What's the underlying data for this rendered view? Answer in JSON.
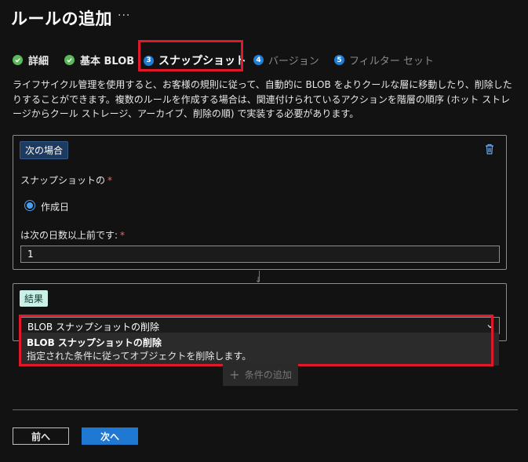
{
  "header": {
    "title": "ルールの追加",
    "more": "···"
  },
  "steps": [
    {
      "label": "詳細",
      "state": "done"
    },
    {
      "label": "基本 BLOB",
      "state": "done"
    },
    {
      "label": "スナップショット",
      "state": "active",
      "num": "3"
    },
    {
      "label": "バージョン",
      "state": "future",
      "num": "4"
    },
    {
      "label": "フィルター セット",
      "state": "future",
      "num": "5"
    }
  ],
  "description": "ライフサイクル管理を使用すると、お客様の規則に従って、自動的に BLOB をよりクールな層に移動したり、削除したりすることができます。複数のルールを作成する場合は、関連付けられているアクションを階層の順序 (ホット ストレージからクール ストレージ、アーカイブ、削除の順) で実装する必要があります。",
  "if_panel": {
    "tag": "次の場合",
    "snapshot_label": "スナップショットの",
    "required_mark": "*",
    "radio_label": "作成日",
    "days_label": "は次の日数以上前です:",
    "days_value": "1"
  },
  "result_panel": {
    "tag": "結果",
    "selected": "BLOB スナップショットの削除",
    "option_title": "BLOB スナップショットの削除",
    "option_desc": "指定された条件に従ってオブジェクトを削除します。"
  },
  "add_condition": {
    "plus": "+",
    "label": "条件の追加"
  },
  "footer": {
    "prev": "前へ",
    "next": "次へ"
  },
  "colors": {
    "highlight": "#e0192a",
    "accent": "#1f78d1",
    "success": "#5bb85b"
  }
}
